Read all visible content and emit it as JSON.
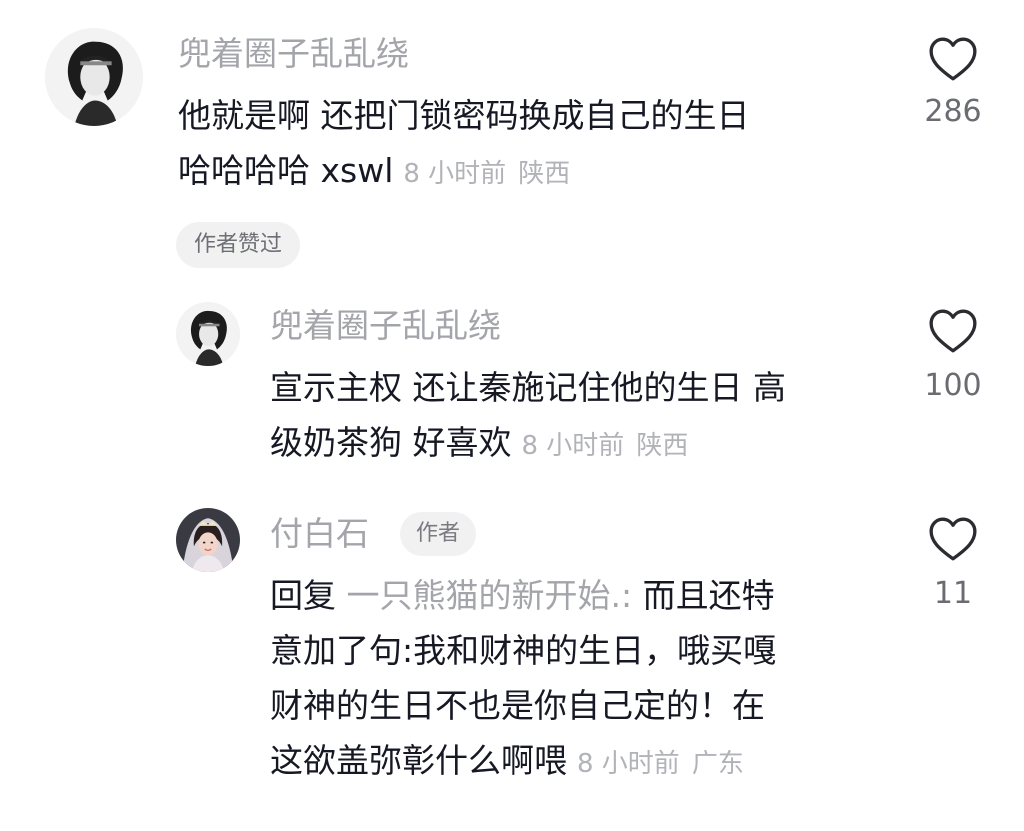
{
  "comments": [
    {
      "username": "兜着圈子乱乱绕",
      "avatar": "user-avatar-bw-portrait",
      "lines": [
        "他就是啊 还把门锁密码换成自己的生日",
        "哈哈哈哈 xswl"
      ],
      "time": "8 小时前",
      "location": "陕西",
      "author_liked_label": "作者赞过",
      "like_count": "286",
      "like_icon": "heart-outline-icon"
    },
    {
      "username": "兜着圈子乱乱绕",
      "avatar": "user-avatar-bw-portrait",
      "lines": [
        "宣示主权 还让秦施记住他的生日 高",
        "级奶茶狗 好喜欢"
      ],
      "time": "8 小时前",
      "location": "陕西",
      "like_count": "100",
      "like_icon": "heart-outline-icon"
    },
    {
      "username": "付白石",
      "avatar": "author-avatar-bride-portrait",
      "author_badge": "作者",
      "reply_prefix": "回复",
      "reply_target": "一只熊猫的新开始.:",
      "line1_rest": " 而且还特",
      "lines": [
        "意加了句:我和财神的生日，哦买嘎",
        "财神的生日不也是你自己定的！在",
        "这欲盖弥彰什么啊喂"
      ],
      "time": "8 小时前",
      "location": "广东",
      "like_count": "11",
      "like_icon": "heart-outline-icon"
    }
  ],
  "colors": {
    "text_primary": "#161823",
    "text_secondary": "#a4a5ab",
    "badge_bg": "#f1f1f2"
  }
}
